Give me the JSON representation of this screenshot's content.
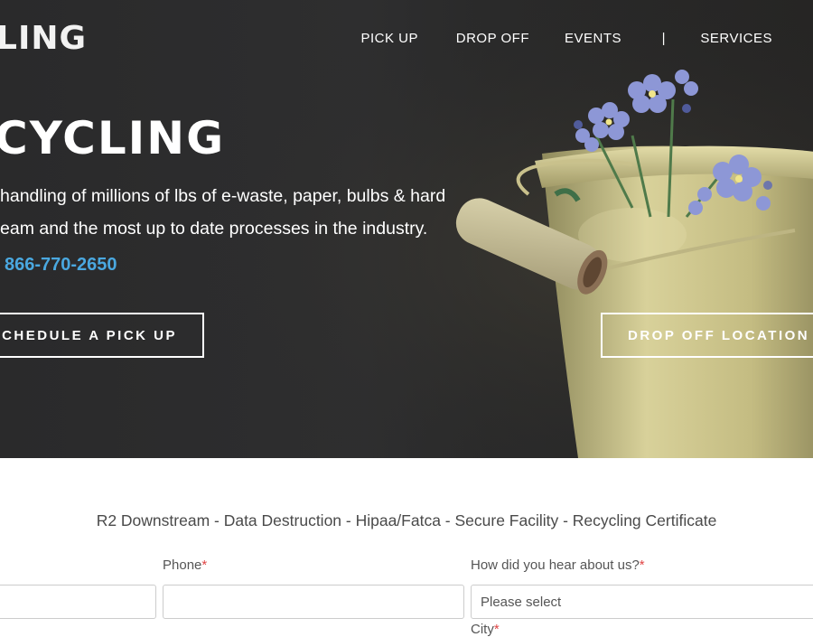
{
  "header": {
    "logo_text": "LING",
    "nav": [
      "PICK UP",
      "DROP OFF",
      "EVENTS",
      "|",
      "SERVICES"
    ]
  },
  "hero": {
    "title": "CYCLING",
    "line1": "handling of millions of lbs of e-waste, paper, bulbs & hard",
    "line2": "eam and the most up to date processes in the industry.",
    "phone": "866-770-2650",
    "pickup_button": "CHEDULE A PICK UP",
    "dropoff_button": "DROP OFF LOCATION"
  },
  "form": {
    "tagline": "R2 Downstream - Data Destruction - Hipaa/Fatca - Secure Facility - Recycling Certificate",
    "phone_label": "Phone",
    "hear_label": "How did you hear about us?",
    "required_mark": "*",
    "hear_select_value": "Please select",
    "city_label": "City"
  },
  "colors": {
    "hero_bg": "#2c2c2d",
    "phone_link": "#4aa8e0",
    "required": "#e04545"
  }
}
